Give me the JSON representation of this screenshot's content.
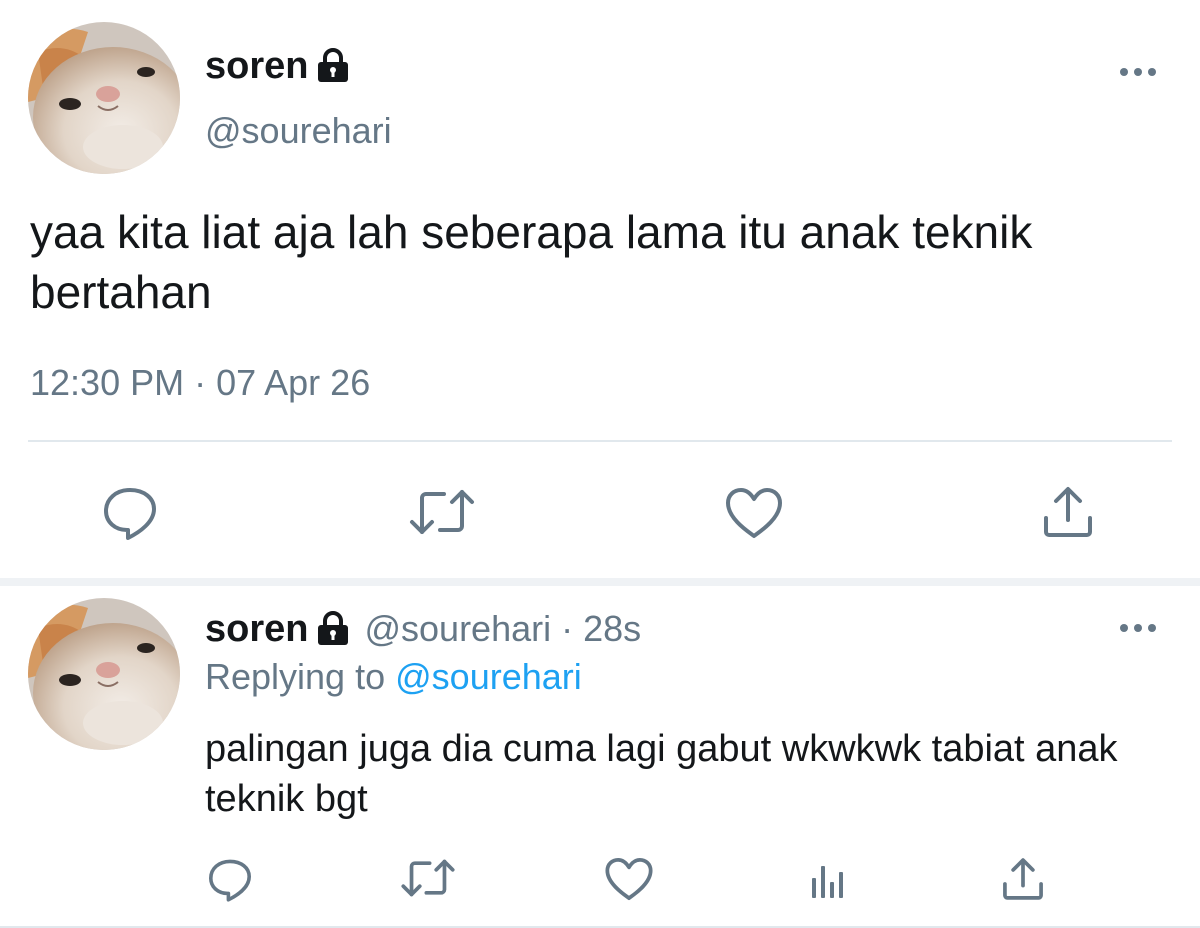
{
  "main_tweet": {
    "display_name": "soren",
    "handle": "@sourehari",
    "text": "yaa kita liat aja lah seberapa lama itu anak teknik bertahan",
    "time": "12:30 PM",
    "separator": "·",
    "date": "07 Apr 26",
    "icons": {
      "lock": "lock-icon",
      "more": "more-icon",
      "reply": "reply-icon",
      "retweet": "retweet-icon",
      "like": "heart-icon",
      "share": "share-icon"
    }
  },
  "reply_tweet": {
    "display_name": "soren",
    "handle": "@sourehari",
    "separator": "·",
    "time_ago": "28s",
    "replying_prefix": "Replying to",
    "replying_to": "@sourehari",
    "text": "palingan juga dia cuma lagi gabut wkwkwk tabiat anak teknik bgt",
    "icons": {
      "lock": "lock-icon",
      "more": "more-icon",
      "reply": "reply-icon",
      "retweet": "retweet-icon",
      "like": "heart-icon",
      "analytics": "analytics-icon",
      "share": "share-icon"
    }
  },
  "colors": {
    "text_primary": "#14171a",
    "text_secondary": "#657786",
    "link": "#1da1f2",
    "divider": "#e1e8ed",
    "icon": "#657786"
  }
}
